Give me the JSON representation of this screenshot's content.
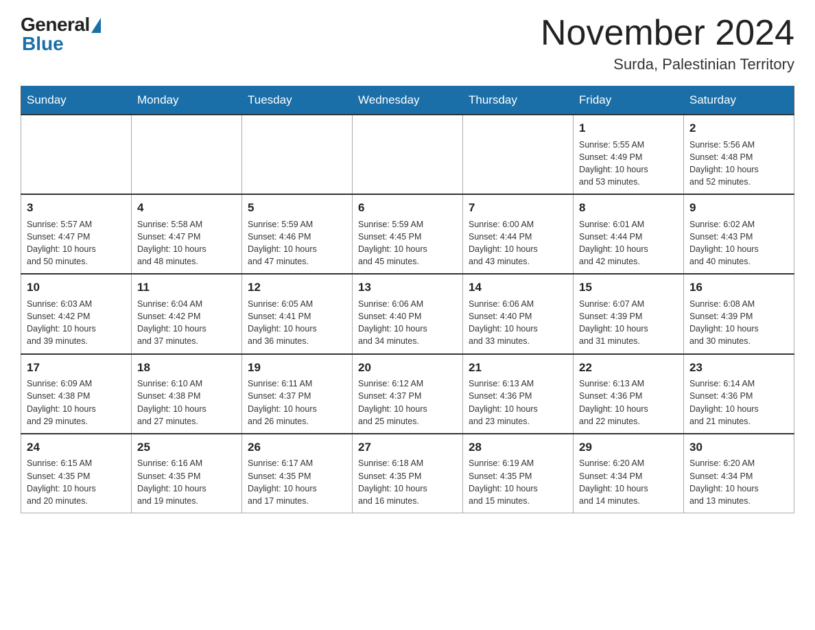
{
  "logo": {
    "general": "General",
    "blue": "Blue"
  },
  "header": {
    "month": "November 2024",
    "location": "Surda, Palestinian Territory"
  },
  "weekdays": [
    "Sunday",
    "Monday",
    "Tuesday",
    "Wednesday",
    "Thursday",
    "Friday",
    "Saturday"
  ],
  "weeks": [
    [
      {
        "day": "",
        "info": ""
      },
      {
        "day": "",
        "info": ""
      },
      {
        "day": "",
        "info": ""
      },
      {
        "day": "",
        "info": ""
      },
      {
        "day": "",
        "info": ""
      },
      {
        "day": "1",
        "info": "Sunrise: 5:55 AM\nSunset: 4:49 PM\nDaylight: 10 hours\nand 53 minutes."
      },
      {
        "day": "2",
        "info": "Sunrise: 5:56 AM\nSunset: 4:48 PM\nDaylight: 10 hours\nand 52 minutes."
      }
    ],
    [
      {
        "day": "3",
        "info": "Sunrise: 5:57 AM\nSunset: 4:47 PM\nDaylight: 10 hours\nand 50 minutes."
      },
      {
        "day": "4",
        "info": "Sunrise: 5:58 AM\nSunset: 4:47 PM\nDaylight: 10 hours\nand 48 minutes."
      },
      {
        "day": "5",
        "info": "Sunrise: 5:59 AM\nSunset: 4:46 PM\nDaylight: 10 hours\nand 47 minutes."
      },
      {
        "day": "6",
        "info": "Sunrise: 5:59 AM\nSunset: 4:45 PM\nDaylight: 10 hours\nand 45 minutes."
      },
      {
        "day": "7",
        "info": "Sunrise: 6:00 AM\nSunset: 4:44 PM\nDaylight: 10 hours\nand 43 minutes."
      },
      {
        "day": "8",
        "info": "Sunrise: 6:01 AM\nSunset: 4:44 PM\nDaylight: 10 hours\nand 42 minutes."
      },
      {
        "day": "9",
        "info": "Sunrise: 6:02 AM\nSunset: 4:43 PM\nDaylight: 10 hours\nand 40 minutes."
      }
    ],
    [
      {
        "day": "10",
        "info": "Sunrise: 6:03 AM\nSunset: 4:42 PM\nDaylight: 10 hours\nand 39 minutes."
      },
      {
        "day": "11",
        "info": "Sunrise: 6:04 AM\nSunset: 4:42 PM\nDaylight: 10 hours\nand 37 minutes."
      },
      {
        "day": "12",
        "info": "Sunrise: 6:05 AM\nSunset: 4:41 PM\nDaylight: 10 hours\nand 36 minutes."
      },
      {
        "day": "13",
        "info": "Sunrise: 6:06 AM\nSunset: 4:40 PM\nDaylight: 10 hours\nand 34 minutes."
      },
      {
        "day": "14",
        "info": "Sunrise: 6:06 AM\nSunset: 4:40 PM\nDaylight: 10 hours\nand 33 minutes."
      },
      {
        "day": "15",
        "info": "Sunrise: 6:07 AM\nSunset: 4:39 PM\nDaylight: 10 hours\nand 31 minutes."
      },
      {
        "day": "16",
        "info": "Sunrise: 6:08 AM\nSunset: 4:39 PM\nDaylight: 10 hours\nand 30 minutes."
      }
    ],
    [
      {
        "day": "17",
        "info": "Sunrise: 6:09 AM\nSunset: 4:38 PM\nDaylight: 10 hours\nand 29 minutes."
      },
      {
        "day": "18",
        "info": "Sunrise: 6:10 AM\nSunset: 4:38 PM\nDaylight: 10 hours\nand 27 minutes."
      },
      {
        "day": "19",
        "info": "Sunrise: 6:11 AM\nSunset: 4:37 PM\nDaylight: 10 hours\nand 26 minutes."
      },
      {
        "day": "20",
        "info": "Sunrise: 6:12 AM\nSunset: 4:37 PM\nDaylight: 10 hours\nand 25 minutes."
      },
      {
        "day": "21",
        "info": "Sunrise: 6:13 AM\nSunset: 4:36 PM\nDaylight: 10 hours\nand 23 minutes."
      },
      {
        "day": "22",
        "info": "Sunrise: 6:13 AM\nSunset: 4:36 PM\nDaylight: 10 hours\nand 22 minutes."
      },
      {
        "day": "23",
        "info": "Sunrise: 6:14 AM\nSunset: 4:36 PM\nDaylight: 10 hours\nand 21 minutes."
      }
    ],
    [
      {
        "day": "24",
        "info": "Sunrise: 6:15 AM\nSunset: 4:35 PM\nDaylight: 10 hours\nand 20 minutes."
      },
      {
        "day": "25",
        "info": "Sunrise: 6:16 AM\nSunset: 4:35 PM\nDaylight: 10 hours\nand 19 minutes."
      },
      {
        "day": "26",
        "info": "Sunrise: 6:17 AM\nSunset: 4:35 PM\nDaylight: 10 hours\nand 17 minutes."
      },
      {
        "day": "27",
        "info": "Sunrise: 6:18 AM\nSunset: 4:35 PM\nDaylight: 10 hours\nand 16 minutes."
      },
      {
        "day": "28",
        "info": "Sunrise: 6:19 AM\nSunset: 4:35 PM\nDaylight: 10 hours\nand 15 minutes."
      },
      {
        "day": "29",
        "info": "Sunrise: 6:20 AM\nSunset: 4:34 PM\nDaylight: 10 hours\nand 14 minutes."
      },
      {
        "day": "30",
        "info": "Sunrise: 6:20 AM\nSunset: 4:34 PM\nDaylight: 10 hours\nand 13 minutes."
      }
    ]
  ]
}
